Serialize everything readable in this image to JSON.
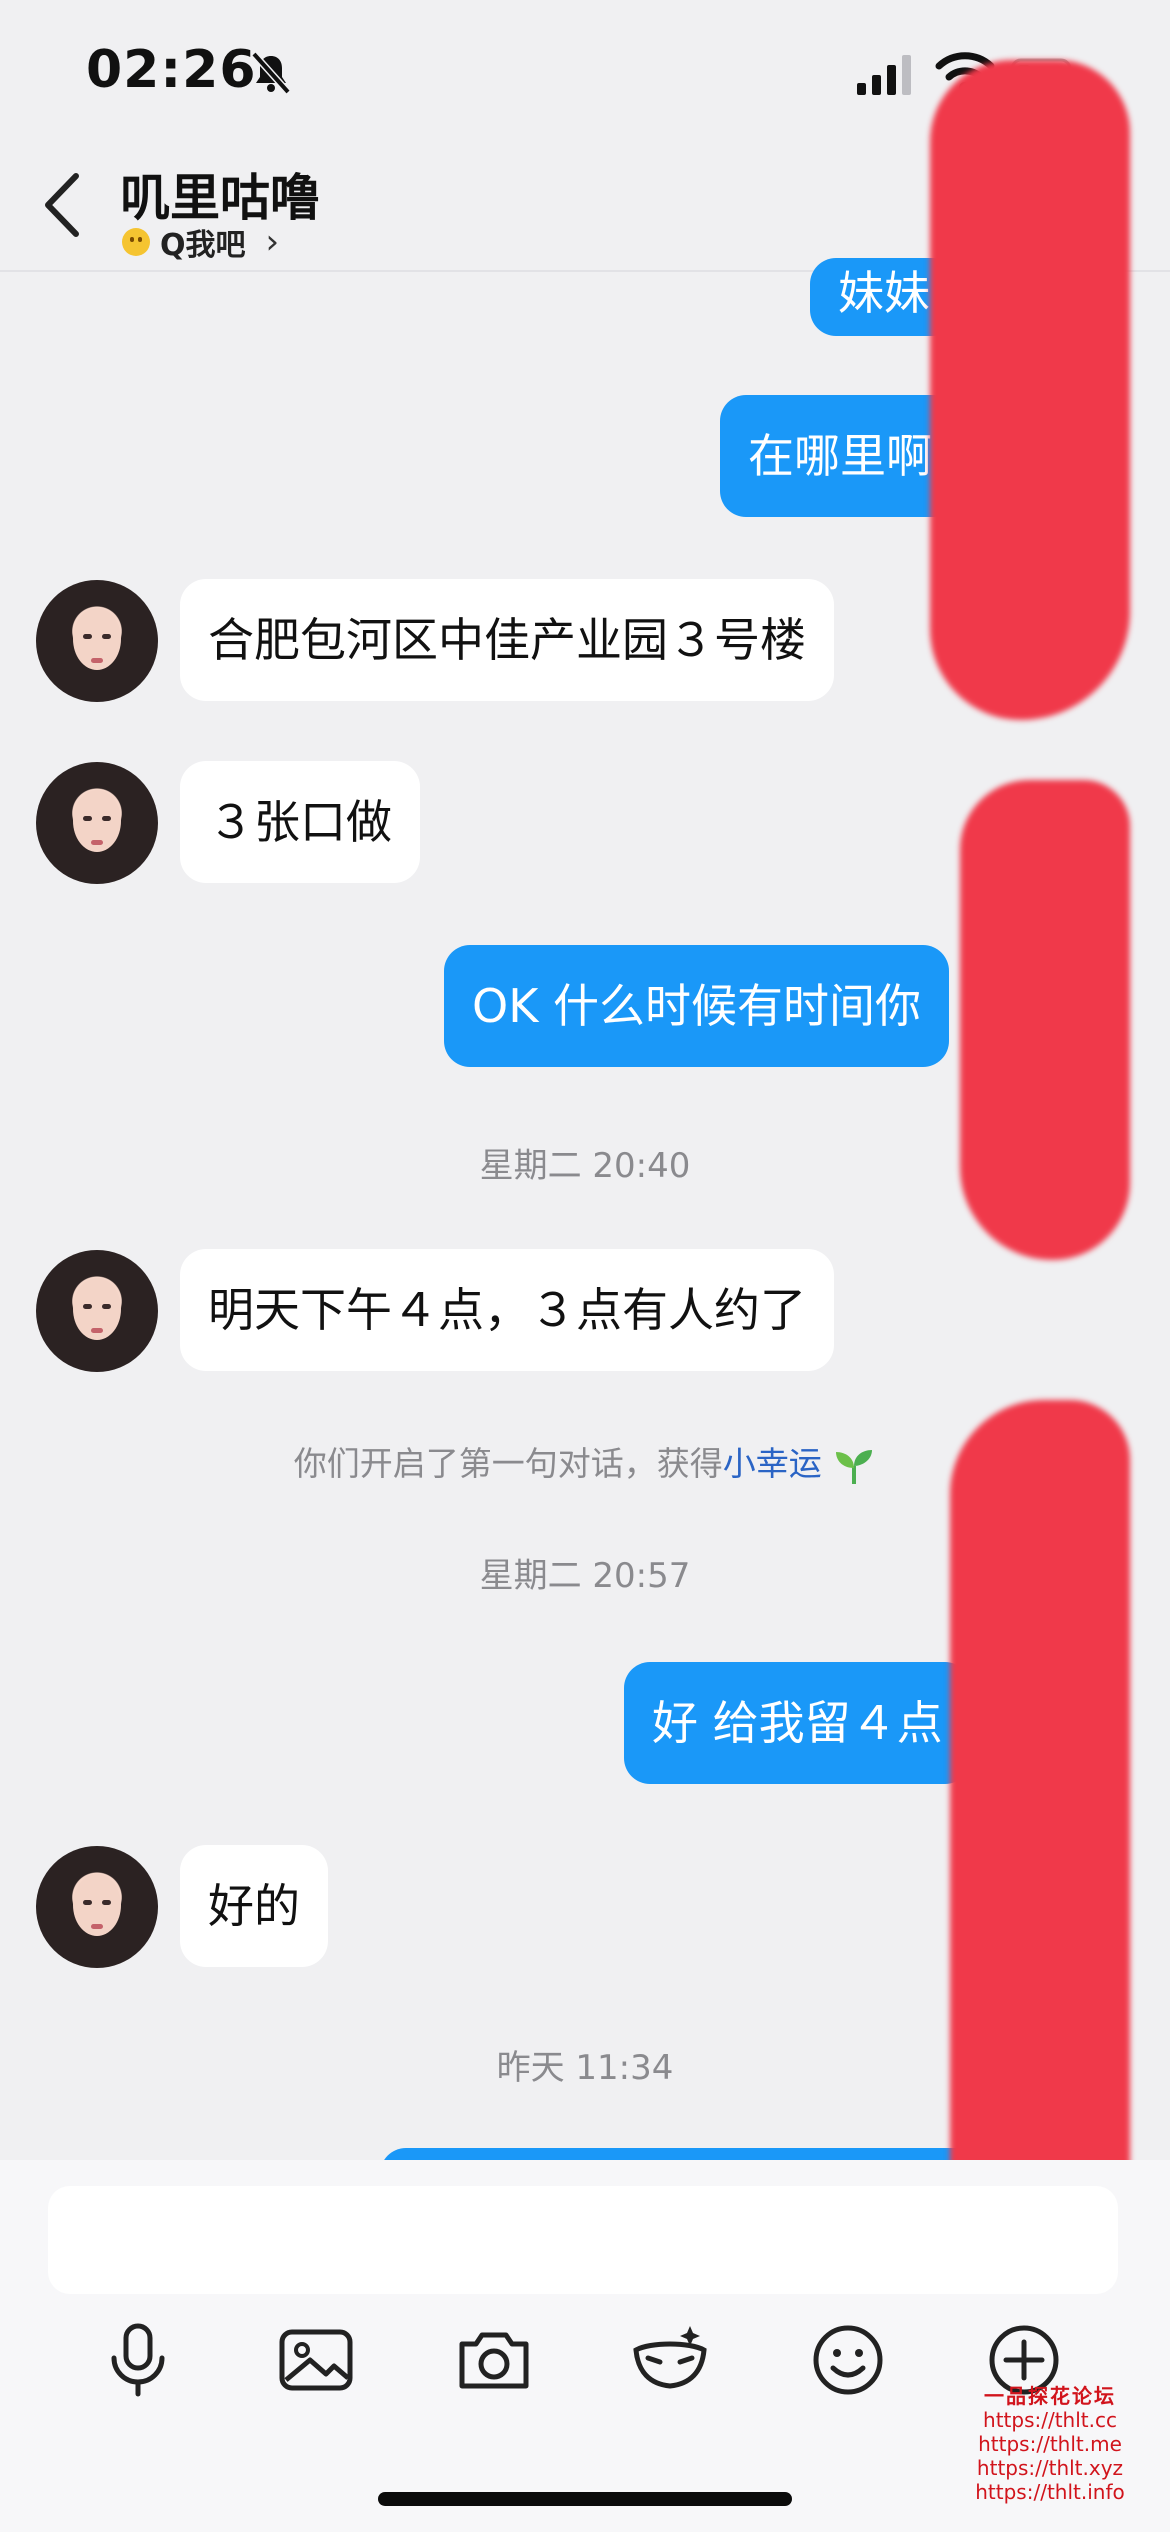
{
  "status_bar": {
    "time": "02:26"
  },
  "header": {
    "title": "叽里咕噜",
    "subtitle": "Q我吧"
  },
  "messages": {
    "m1": "妹妹",
    "m2": "在哪里啊",
    "m3": "合肥包河区中佳产业园３号楼",
    "m4": "３张口做",
    "m5": "OK 什么时候有时间你",
    "ts1": "星期二 20:40",
    "m6": "明天下午４点，３点有人约了",
    "notice_prefix": "你们开启了第一句对话，获得",
    "notice_highlight": "小幸运",
    "ts2": "星期二 20:57",
    "m7": "好 给我留４点",
    "m8": "好的",
    "ts3": "昨天 11:34"
  },
  "watermark": {
    "title": "一品探花论坛",
    "links": [
      "https://thlt.cc",
      "https://thlt.me",
      "https://thlt.xyz",
      "https://thlt.info"
    ]
  },
  "colors": {
    "outgoing_bubble": "#1a98f8",
    "incoming_bubble": "#ffffff",
    "background": "#f0f0f2",
    "redaction": "#f0394a"
  },
  "icons": [
    "back-icon",
    "mute-bell-icon",
    "signal-icon",
    "wifi-icon",
    "battery-icon",
    "microphone-icon",
    "image-icon",
    "camera-icon",
    "mask-icon",
    "emoji-icon",
    "plus-icon"
  ]
}
